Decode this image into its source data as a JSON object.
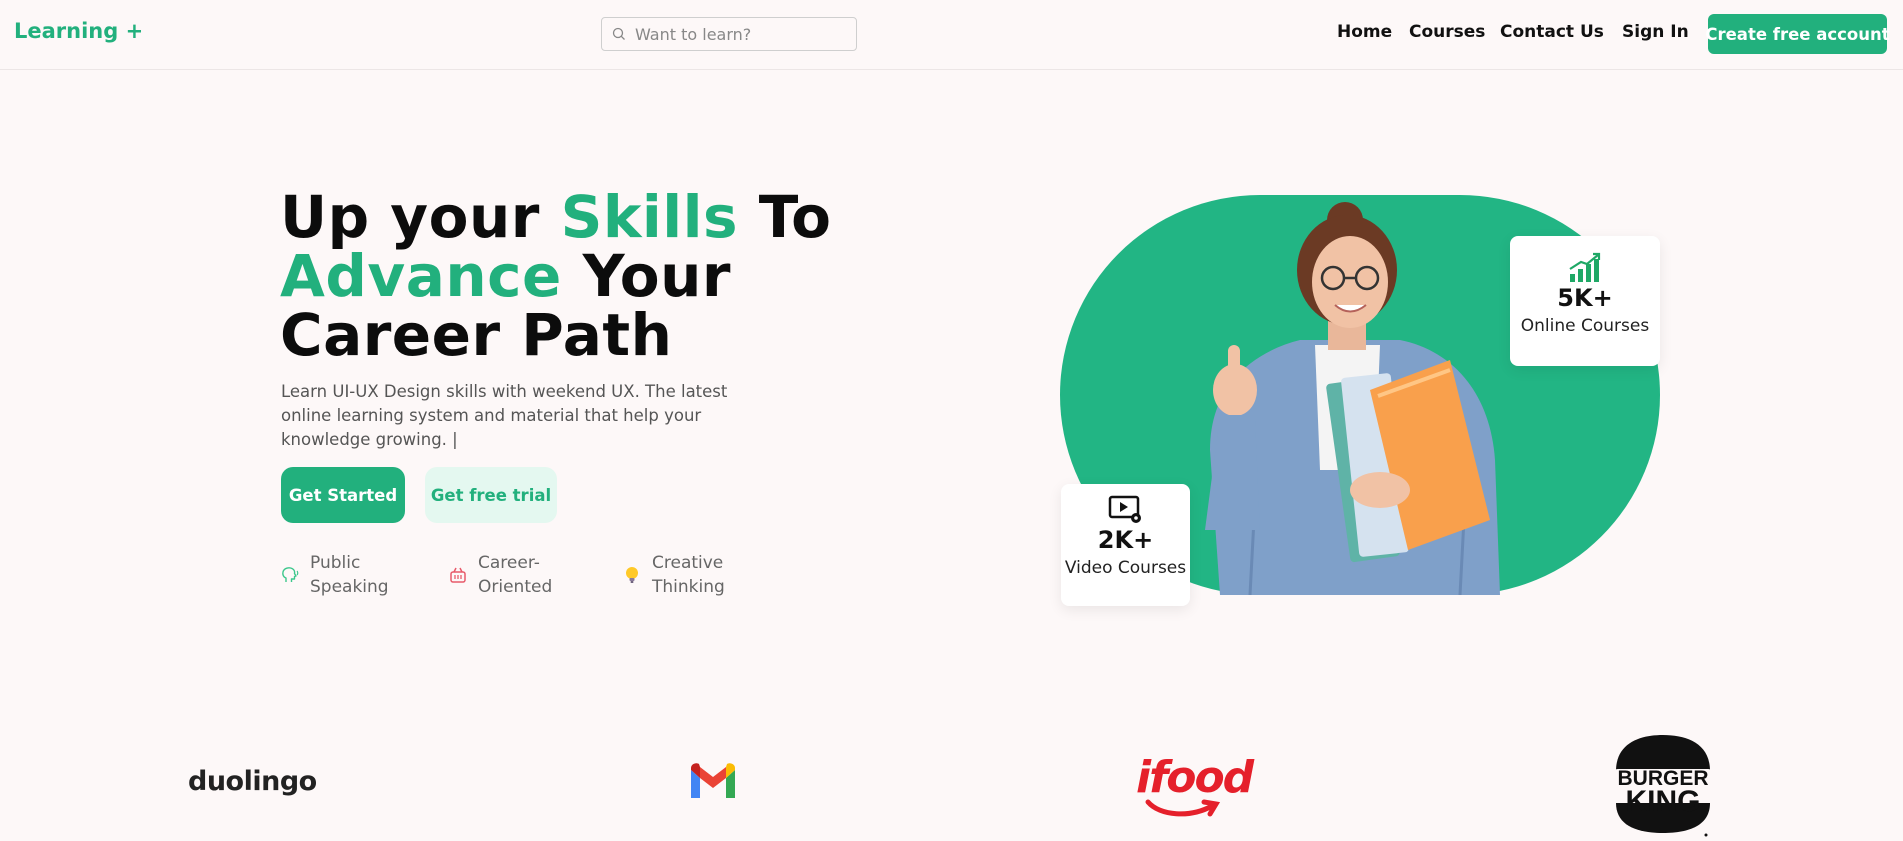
{
  "navbar": {
    "brand": "Learning +",
    "search_placeholder": "Want to learn?",
    "links": [
      "Home",
      "Courses",
      "Contact Us",
      "Sign In"
    ],
    "cta": "Create free account"
  },
  "hero": {
    "title_line1_a": "Up your ",
    "title_line1_b": "Skills",
    "title_line1_c": " To",
    "title_line2_a": "Advance",
    "title_line2_b": " Your",
    "title_line3": "Career Path",
    "subtitle": "Learn UI-UX Design skills with weekend UX. The latest online learning system and material that help your knowledge growing. |",
    "primary_button": "Get Started",
    "secondary_button": "Get free trial",
    "features": [
      "Public Speaking",
      "Career-Oriented",
      "Creative Thinking"
    ]
  },
  "stats": {
    "online": {
      "value": "5K+",
      "label": "Online Courses"
    },
    "video": {
      "value": "2K+",
      "label": "Video Courses"
    }
  },
  "partners": [
    "duolingo",
    "Gmail",
    "ifood",
    "BURGER KING"
  ],
  "colors": {
    "accent": "#22b07d",
    "background": "#fdf8f8",
    "accent_light": "#e4f8f0"
  }
}
